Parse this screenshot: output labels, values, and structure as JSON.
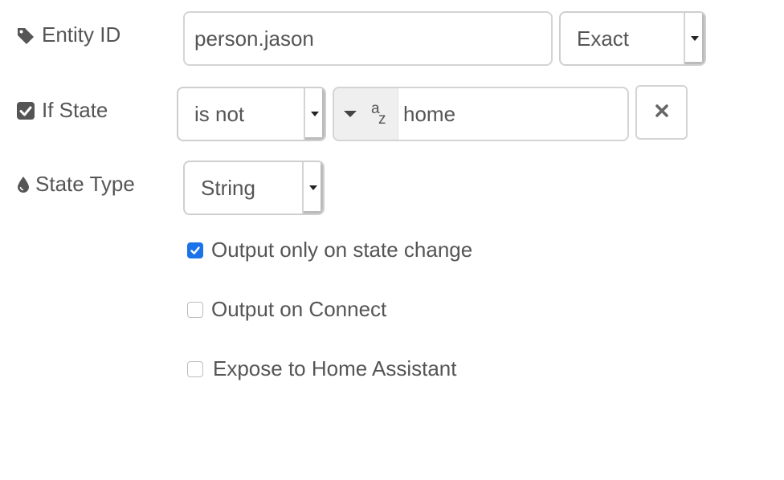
{
  "colors": {
    "label_text": "#555555",
    "checkbox_checked": "#1a73e8",
    "border": "#d4d4d4",
    "type_button_bg": "#efefef"
  },
  "entity_id": {
    "label": "Entity ID",
    "icon": "tag-icon",
    "value": "person.jason",
    "match_select": {
      "selected": "Exact"
    }
  },
  "if_state": {
    "label": "If State",
    "icon": "checkbox-checked-icon",
    "operator_select": {
      "selected": "is not"
    },
    "value_type_icon": "alpha-string-icon",
    "value": "home",
    "remove_icon": "close-icon"
  },
  "state_type": {
    "label": "State Type",
    "icon": "droplet-icon",
    "select": {
      "selected": "String"
    }
  },
  "options": [
    {
      "label": "Output only on state change",
      "checked": true
    },
    {
      "label": "Output on Connect",
      "checked": false
    },
    {
      "label": "Expose to Home Assistant",
      "checked": false
    }
  ]
}
